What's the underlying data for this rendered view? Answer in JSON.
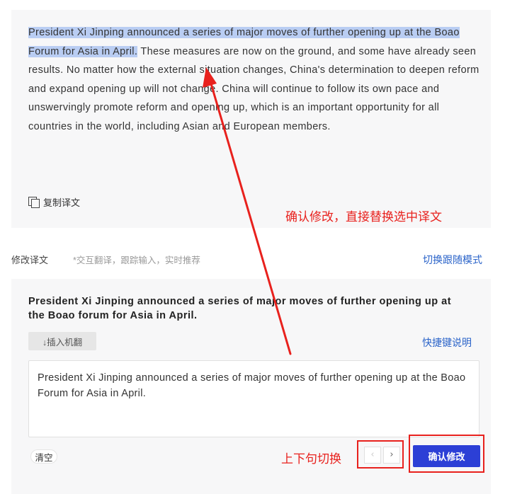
{
  "translation": {
    "highlighted": "President Xi Jinping announced a series of major moves of further opening up at the Boao Forum for Asia in April.",
    "rest": " These measures are now on the ground, and some have already seen results. No matter how the external situation changes, China's determination to deepen reform and expand opening up will not change. China will continue to follow its own pace and unswervingly promote reform and opening up, which is an important opportunity for all countries in the world, including Asian and European members.",
    "copy_label": "复制译文"
  },
  "annotations": {
    "confirm_note": "确认修改，直接替换选中译文",
    "nav_note": "上下句切换"
  },
  "editor": {
    "title": "修改译文",
    "hint": "*交互翻译，跟踪输入，实时推荐",
    "switch_mode": "切换跟随模式",
    "source_sentence": "President Xi Jinping announced a series of major moves of further opening up at the Boao forum for Asia in April.",
    "insert_label": "↓插入机翻",
    "shortcut_label": "快捷键说明",
    "edit_text": "President Xi Jinping announced a series of major moves of further opening up at the Boao Forum for Asia in April.",
    "clear_label": "清空",
    "prev_label": "‹",
    "next_label": "›",
    "confirm_label": "确认修改"
  },
  "colors": {
    "annotation_red": "#e8211d",
    "confirm_blue": "#2c3fd6",
    "link_blue": "#2a63c9",
    "highlight": "#b9cdf3"
  }
}
